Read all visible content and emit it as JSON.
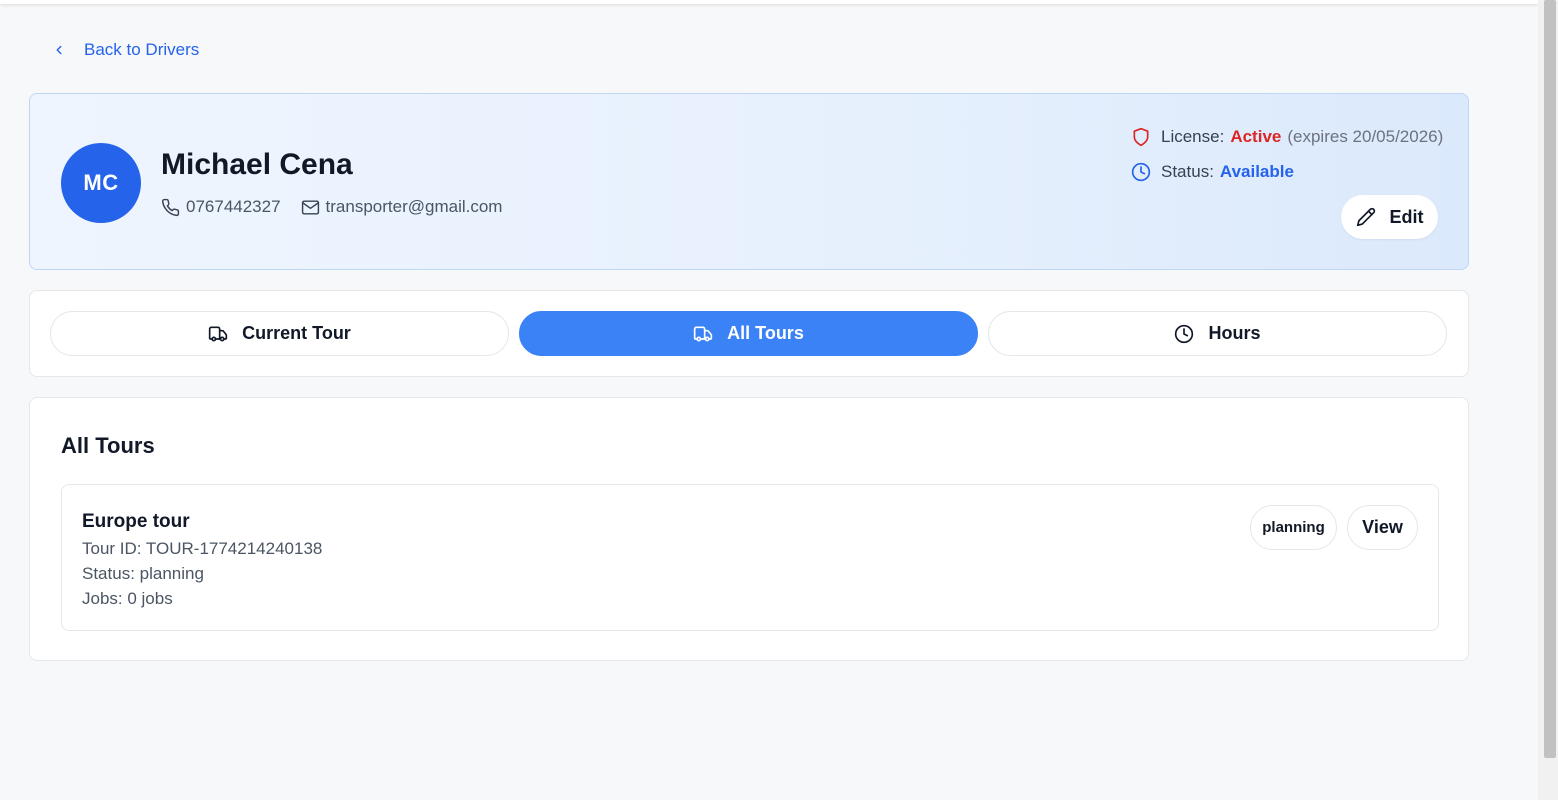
{
  "nav": {
    "back_label": "Back to Drivers"
  },
  "driver": {
    "initials": "MC",
    "name": "Michael Cena",
    "phone": "0767442327",
    "email": "transporter@gmail.com",
    "license_label": "License:",
    "license_status": "Active",
    "license_expiry": "(expires 20/05/2026)",
    "status_label": "Status:",
    "status_value": "Available"
  },
  "actions": {
    "edit_label": "Edit"
  },
  "tabs": [
    {
      "label": "Current Tour",
      "icon": "truck-icon",
      "active": false
    },
    {
      "label": "All Tours",
      "icon": "truck-icon",
      "active": true
    },
    {
      "label": "Hours",
      "icon": "clock-icon",
      "active": false
    }
  ],
  "tours_section": {
    "title": "All Tours",
    "items": [
      {
        "name": "Europe tour",
        "tour_id_text": "Tour ID: TOUR-1774214240138",
        "status_text": "Status: planning",
        "jobs_text": "Jobs: 0 jobs",
        "badge": "planning",
        "view_label": "View"
      }
    ]
  },
  "colors": {
    "accent": "#2563eb",
    "tab_active": "#3b82f6",
    "license_active": "#dc2626"
  }
}
